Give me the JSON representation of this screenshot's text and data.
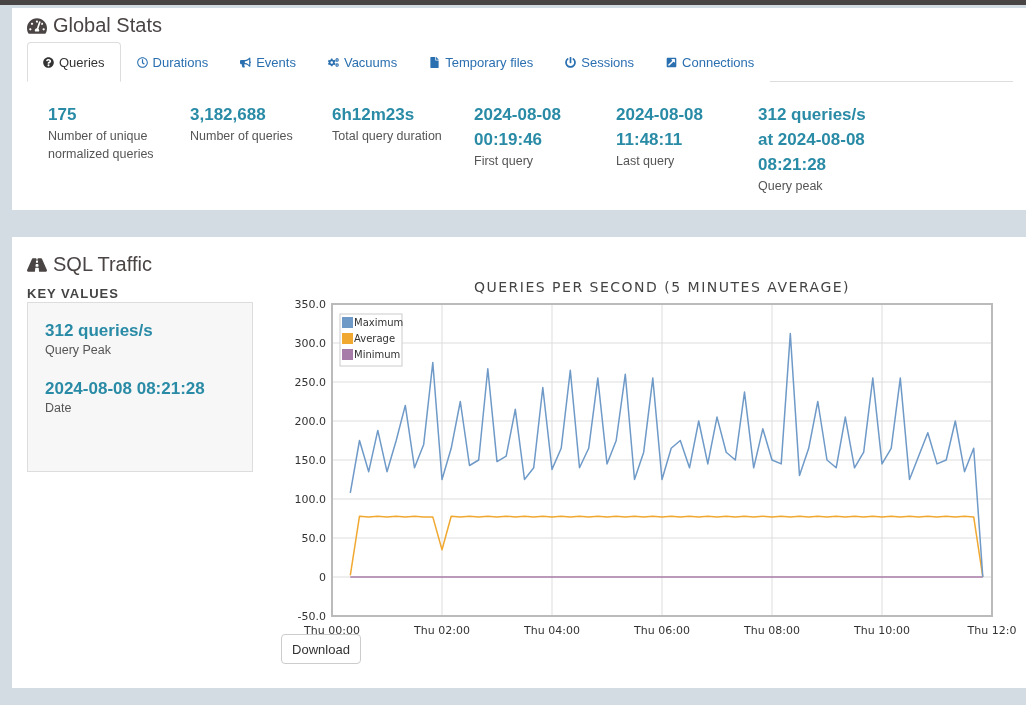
{
  "global_stats": {
    "title": "Global Stats",
    "tabs": [
      {
        "label": "Queries",
        "selected": true
      },
      {
        "label": "Durations",
        "selected": false
      },
      {
        "label": "Events",
        "selected": false
      },
      {
        "label": "Vacuums",
        "selected": false
      },
      {
        "label": "Temporary files",
        "selected": false
      },
      {
        "label": "Sessions",
        "selected": false
      },
      {
        "label": "Connections",
        "selected": false
      }
    ],
    "stats": [
      {
        "value": [
          "175"
        ],
        "label": "Number of unique normalized queries"
      },
      {
        "value": [
          "3,182,688"
        ],
        "label": "Number of queries"
      },
      {
        "value": [
          "6h12m23s"
        ],
        "label": "Total query duration"
      },
      {
        "value": [
          "2024-08-08",
          "00:19:46"
        ],
        "label": "First query"
      },
      {
        "value": [
          "2024-08-08",
          "11:48:11"
        ],
        "label": "Last query"
      },
      {
        "value": [
          "312 queries/s",
          "at 2024-08-08",
          "08:21:28"
        ],
        "label": "Query peak"
      }
    ]
  },
  "sql_traffic": {
    "title": "SQL Traffic",
    "key_values_heading": "KEY VALUES",
    "key_values": [
      {
        "value": "312 queries/s",
        "label": "Query Peak"
      },
      {
        "value": "2024-08-08 08:21:28",
        "label": "Date"
      }
    ],
    "chart_data": {
      "type": "line",
      "title": "QUERIES PER SECOND (5 MINUTES AVERAGE)",
      "categories": [
        "Thu 00:00",
        null,
        null,
        null,
        null,
        null,
        null,
        null,
        null,
        null,
        null,
        null,
        "Thu 02:00",
        null,
        null,
        null,
        null,
        null,
        null,
        null,
        null,
        null,
        null,
        null,
        "Thu 04:00",
        null,
        null,
        null,
        null,
        null,
        null,
        null,
        null,
        null,
        null,
        null,
        "Thu 06:00",
        null,
        null,
        null,
        null,
        null,
        null,
        null,
        null,
        null,
        null,
        null,
        "Thu 08:00",
        null,
        null,
        null,
        null,
        null,
        null,
        null,
        null,
        null,
        null,
        null,
        "Thu 10:00",
        null,
        null,
        null,
        null,
        null,
        null,
        null,
        null,
        null,
        null,
        null,
        "Thu 12:0"
      ],
      "series": [
        {
          "name": "Maximum",
          "color": "#6f9ac8",
          "values": [
            null,
            null,
            108,
            175,
            135,
            188,
            135,
            175,
            220,
            140,
            170,
            275,
            125,
            165,
            225,
            143,
            150,
            267,
            148,
            155,
            215,
            125,
            140,
            243,
            138,
            165,
            265,
            140,
            165,
            255,
            145,
            175,
            260,
            125,
            160,
            255,
            125,
            165,
            175,
            140,
            200,
            145,
            205,
            160,
            150,
            237,
            140,
            190,
            150,
            145,
            312,
            130,
            165,
            225,
            150,
            140,
            205,
            140,
            160,
            255,
            145,
            165,
            255,
            125,
            155,
            185,
            145,
            150,
            200,
            135,
            165,
            0,
            null
          ]
        },
        {
          "name": "Average",
          "color": "#f0a830",
          "values": [
            null,
            null,
            2,
            78,
            77,
            78,
            77,
            78,
            77,
            78,
            77,
            77,
            35,
            78,
            77,
            78,
            77,
            78,
            77,
            78,
            77,
            78,
            77,
            78,
            77,
            78,
            77,
            78,
            77,
            78,
            77,
            78,
            77,
            78,
            77,
            78,
            77,
            78,
            77,
            78,
            77,
            78,
            77,
            78,
            77,
            78,
            77,
            78,
            77,
            78,
            77,
            78,
            77,
            78,
            77,
            78,
            77,
            78,
            77,
            78,
            77,
            78,
            77,
            78,
            77,
            78,
            77,
            78,
            77,
            78,
            77,
            0,
            null
          ]
        },
        {
          "name": "Minimum",
          "color": "#a87ca8",
          "values": [
            null,
            null,
            0,
            0,
            0,
            0,
            0,
            0,
            0,
            0,
            0,
            0,
            0,
            0,
            0,
            0,
            0,
            0,
            0,
            0,
            0,
            0,
            0,
            0,
            0,
            0,
            0,
            0,
            0,
            0,
            0,
            0,
            0,
            0,
            0,
            0,
            0,
            0,
            0,
            0,
            0,
            0,
            0,
            0,
            0,
            0,
            0,
            0,
            0,
            0,
            0,
            0,
            0,
            0,
            0,
            0,
            0,
            0,
            0,
            0,
            0,
            0,
            0,
            0,
            0,
            0,
            0,
            0,
            0,
            0,
            0,
            0,
            null
          ]
        }
      ],
      "ylim": [
        -50,
        350
      ],
      "grid": true,
      "legend": true,
      "yticks": [
        {
          "value": -50,
          "label": "-50.0"
        },
        {
          "value": 0,
          "label": "0"
        },
        {
          "value": 50,
          "label": "50.0"
        },
        {
          "value": 100,
          "label": "100.0"
        },
        {
          "value": 150,
          "label": "150.0"
        },
        {
          "value": 200,
          "label": "200.0"
        },
        {
          "value": 250,
          "label": "250.0"
        },
        {
          "value": 300,
          "label": "300.0"
        },
        {
          "value": 350,
          "label": "350.0"
        }
      ]
    },
    "download_button": "Download"
  }
}
